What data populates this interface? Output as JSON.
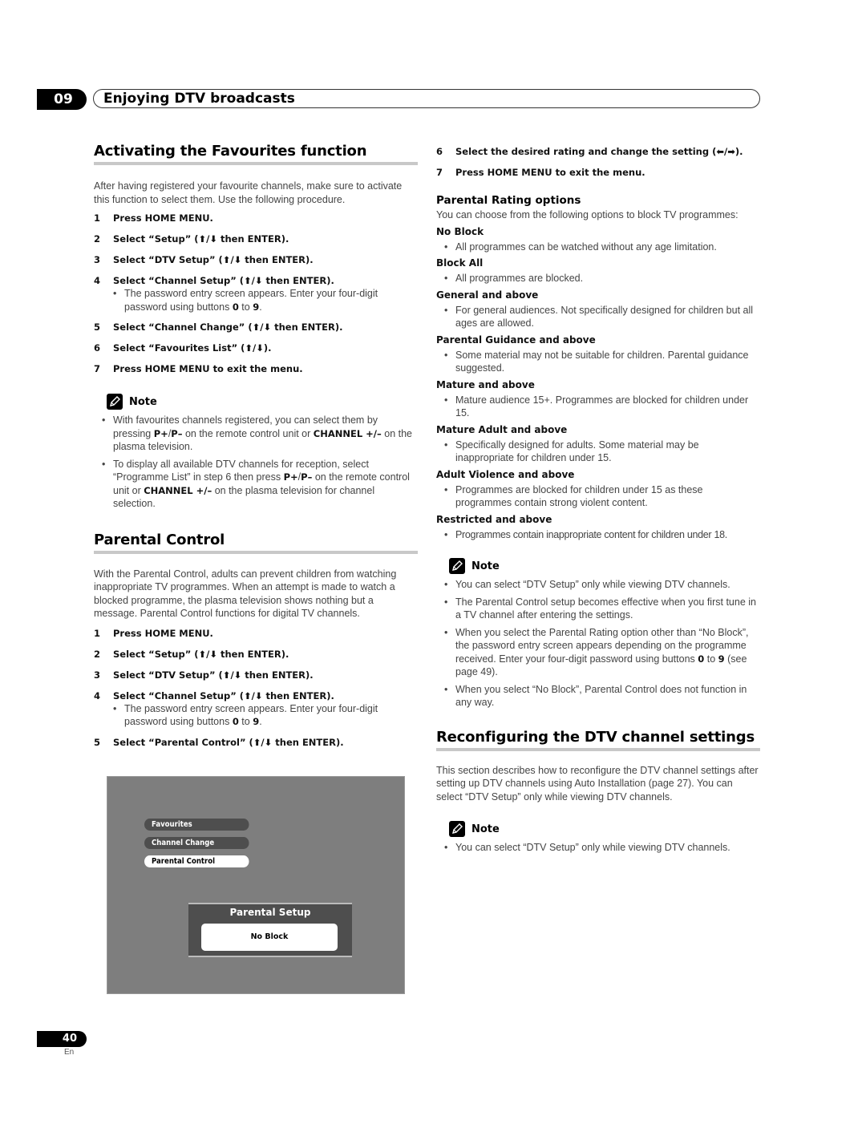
{
  "chapter": {
    "number": "09",
    "title": "Enjoying DTV broadcasts"
  },
  "favourites": {
    "heading": "Activating the Favourites function",
    "intro": "After having registered your favourite channels, make sure to activate this function to select them. Use the following procedure.",
    "steps": [
      {
        "num": "1",
        "text": "Press HOME MENU."
      },
      {
        "num": "2",
        "text": "Select “Setup” (⬆/⬇ then ENTER)."
      },
      {
        "num": "3",
        "text": "Select “DTV Setup” (⬆/⬇ then ENTER)."
      },
      {
        "num": "4",
        "text": "Select “Channel Setup” (⬆/⬇ then ENTER).",
        "sub_pre": "The password entry screen appears. Enter your four-digit password using buttons ",
        "sub_b1": "0",
        "sub_mid": " to ",
        "sub_b2": "9",
        "sub_post": "."
      },
      {
        "num": "5",
        "text": "Select “Channel Change” (⬆/⬇ then ENTER)."
      },
      {
        "num": "6",
        "text": "Select “Favourites List” (⬆/⬇)."
      },
      {
        "num": "7",
        "text": "Press HOME MENU to exit the menu."
      }
    ],
    "note_label": "Note",
    "notes": [
      {
        "t1": "With favourites channels registered, you can select them by pressing ",
        "b1": "P+",
        "t2": "/",
        "b2": "P–",
        "t3": " on the remote control unit or ",
        "b3": "CHANNEL +/–",
        "t4": " on the plasma television."
      },
      {
        "t1": "To display all available DTV channels for reception, select “Programme List” in step 6 then press ",
        "b1": "P+",
        "t2": "/",
        "b2": "P–",
        "t3": " on the remote control unit or ",
        "b3": "CHANNEL +/–",
        "t4": " on the plasma television for channel selection."
      }
    ]
  },
  "parental": {
    "heading": "Parental Control",
    "intro": "With the Parental Control, adults can prevent children from watching inappropriate TV programmes. When an attempt is made to watch a blocked programme, the plasma television shows nothing but a message. Parental Control functions for digital TV channels.",
    "steps": [
      {
        "num": "1",
        "text": "Press HOME MENU."
      },
      {
        "num": "2",
        "text": "Select “Setup” (⬆/⬇ then ENTER)."
      },
      {
        "num": "3",
        "text": "Select “DTV Setup” (⬆/⬇ then ENTER)."
      },
      {
        "num": "4",
        "text": "Select “Channel Setup” (⬆/⬇ then ENTER).",
        "sub_pre": "The password entry screen appears. Enter your four-digit password using buttons ",
        "sub_b1": "0",
        "sub_mid": " to ",
        "sub_b2": "9",
        "sub_post": "."
      },
      {
        "num": "5",
        "text": "Select “Parental Control” (⬆/⬇ then ENTER)."
      },
      {
        "num": "6",
        "text": "Select the desired rating and change the setting (⬅/➡)."
      },
      {
        "num": "7",
        "text": "Press HOME MENU to exit the menu."
      }
    ],
    "tv_screen": {
      "menu_items": [
        "Favourites",
        "Channel Change",
        "Parental Control"
      ],
      "selected_item": "Parental Control",
      "panel_title": "Parental Setup",
      "panel_value": "No Block"
    }
  },
  "rating_options": {
    "heading": "Parental Rating options",
    "intro": "You can choose from the following options to block TV programmes:",
    "options": [
      {
        "name": "No Block",
        "desc": "All programmes can be watched without any age limitation."
      },
      {
        "name": "Block All",
        "desc": "All programmes are blocked."
      },
      {
        "name": "General and above",
        "desc": "For general audiences. Not specifically designed for children but all ages are allowed."
      },
      {
        "name": "Parental Guidance and above",
        "desc": "Some material may not be suitable for children. Parental guidance suggested."
      },
      {
        "name": "Mature and above",
        "desc": "Mature audience 15+. Programmes are blocked for children under 15."
      },
      {
        "name": "Mature Adult and above",
        "desc": "Specifically designed for adults. Some material may be inappropriate for children under 15."
      },
      {
        "name": "Adult Violence and above",
        "desc": "Programmes are blocked for children under 15 as these programmes contain strong violent content."
      },
      {
        "name": "Restricted and above",
        "desc": "Programmes contain inappropriate content for children under 18."
      }
    ],
    "note_label": "Note",
    "notes": [
      {
        "t1": "You can select “DTV Setup” only while viewing DTV channels."
      },
      {
        "t1": "The Parental Control setup becomes effective when you first tune in a TV channel after entering the settings."
      },
      {
        "t1": "When you select the Parental Rating option other than “No Block”, the password entry screen appears depending on the programme received. Enter your four-digit password using buttons ",
        "b1": "0",
        "t2": " to ",
        "b2": "9",
        "t3": " (see page 49)."
      },
      {
        "t1": "When you select “No Block”, Parental Control does not function in any way."
      }
    ]
  },
  "reconfigure": {
    "heading": "Reconfiguring the DTV channel settings",
    "intro": "This section describes how to reconfigure the DTV channel settings after setting up DTV channels using Auto Installation (page 27). You can select “DTV Setup” only while viewing DTV channels.",
    "note_label": "Note",
    "notes": [
      {
        "t1": "You can select “DTV Setup” only while viewing DTV channels."
      }
    ]
  },
  "footer": {
    "page_number": "40",
    "language": "En"
  }
}
